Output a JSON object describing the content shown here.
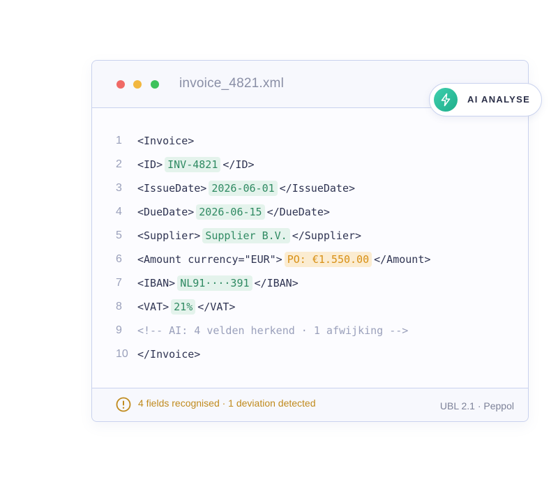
{
  "window": {
    "filename": "invoice_4821.xml",
    "ai_button_label": "AI ANALYSE"
  },
  "code_lines": [
    {
      "num": "1",
      "parts": [
        {
          "t": "<Invoice>"
        }
      ]
    },
    {
      "num": "2",
      "parts": [
        {
          "t": "<ID>"
        },
        {
          "t": "INV-4821",
          "hl": "ok"
        },
        {
          "t": "</ID>"
        }
      ]
    },
    {
      "num": "3",
      "parts": [
        {
          "t": "<IssueDate>"
        },
        {
          "t": "2026-06-01",
          "hl": "ok"
        },
        {
          "t": "</IssueDate>"
        }
      ]
    },
    {
      "num": "4",
      "parts": [
        {
          "t": "<DueDate>"
        },
        {
          "t": "2026-06-15",
          "hl": "ok"
        },
        {
          "t": "</DueDate>"
        }
      ]
    },
    {
      "num": "5",
      "parts": [
        {
          "t": "<Supplier>"
        },
        {
          "t": "Supplier B.V.",
          "hl": "ok"
        },
        {
          "t": "</Supplier>"
        }
      ]
    },
    {
      "num": "6",
      "parts": [
        {
          "t": "<Amount currency=\"EUR\">"
        },
        {
          "t": "PO: €1.550.00",
          "hl": "warn"
        },
        {
          "t": "</Amount>"
        }
      ]
    },
    {
      "num": "7",
      "parts": [
        {
          "t": "<IBAN>"
        },
        {
          "t": "NL91····391",
          "hl": "ok"
        },
        {
          "t": "</IBAN>"
        }
      ]
    },
    {
      "num": "8",
      "parts": [
        {
          "t": "<VAT>"
        },
        {
          "t": "21%",
          "hl": "ok"
        },
        {
          "t": "</VAT>"
        }
      ]
    },
    {
      "num": "9",
      "parts": [
        {
          "t": "<!-- AI: 4 velden herkend · 1 afwijking -->",
          "hl": "comment"
        }
      ]
    },
    {
      "num": "10",
      "parts": [
        {
          "t": "</Invoice>"
        }
      ]
    }
  ],
  "footer": {
    "status": "4 fields recognised · 1 deviation detected",
    "meta": "UBL 2.1 · Peppol",
    "status_icon": "warning-circle-icon"
  },
  "colors": {
    "accent_green": "#2f8a62",
    "warn_amber": "#d89015",
    "border": "#c9d2ee"
  }
}
